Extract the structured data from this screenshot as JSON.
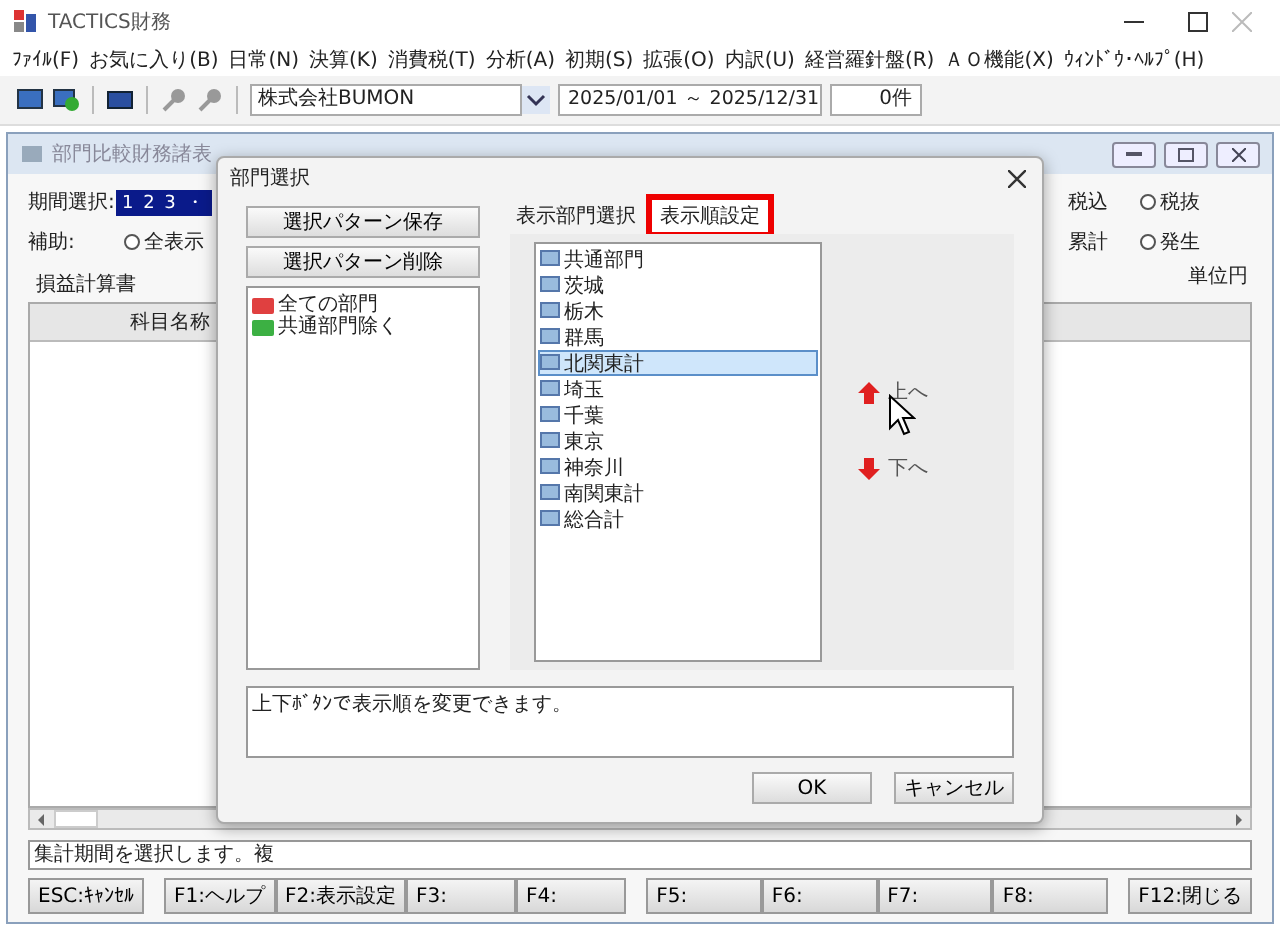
{
  "window": {
    "title": "TACTICS財務"
  },
  "menu": [
    "ﾌｧｲﾙ(F)",
    "お気に入り(B)",
    "日常(N)",
    "決算(K)",
    "消費税(T)",
    "分析(A)",
    "初期(S)",
    "拡張(O)",
    "内訳(U)",
    "経営羅針盤(R)",
    "ＡＯ機能(X)",
    "ｳｨﾝﾄﾞｳ･ﾍﾙﾌﾟ(H)"
  ],
  "toolbar": {
    "company": "株式会社BUMON",
    "period": "2025/01/01 ～ 2025/12/31",
    "count": "0件"
  },
  "report_window": {
    "title": "部門比較財務諸表",
    "period_label": "期間選択:",
    "period_value": "1 2 3 ・",
    "aux_label": "補助:",
    "aux_options": [
      {
        "label": "全表示",
        "selected": false
      }
    ],
    "tax_options": [
      {
        "kind": "text",
        "label": "税込"
      },
      {
        "kind": "radio",
        "label": "税抜",
        "selected": false
      }
    ],
    "sum_options": [
      {
        "kind": "text",
        "label": "累計"
      },
      {
        "kind": "radio",
        "label": "発生",
        "selected": false
      }
    ],
    "unit": "単位円",
    "tab": "損益計算書",
    "column": "科目名称",
    "status": "集計期間を選択します。複"
  },
  "function_keys": [
    "ESC:ｷｬﾝｾﾙ",
    "F1:ヘルプ",
    "F2:表示設定",
    "F3:",
    "F4:",
    "F5:",
    "F6:",
    "F7:",
    "F8:",
    "F12:閉じる"
  ],
  "dialog": {
    "title": "部門選択",
    "buttons": [
      "選択パターン保存",
      "選択パターン削除"
    ],
    "patterns": [
      {
        "label": "全ての部門",
        "color": "#e04040"
      },
      {
        "label": "共通部門除く",
        "color": "#3cb043"
      }
    ],
    "tabs": [
      {
        "label": "表示部門選択",
        "selected": false
      },
      {
        "label": "表示順設定",
        "selected": true
      }
    ],
    "departments": [
      {
        "label": "共通部門",
        "selected": false
      },
      {
        "label": "茨城",
        "selected": false
      },
      {
        "label": "栃木",
        "selected": false
      },
      {
        "label": "群馬",
        "selected": false
      },
      {
        "label": "北関東計",
        "selected": true
      },
      {
        "label": "埼玉",
        "selected": false
      },
      {
        "label": "千葉",
        "selected": false
      },
      {
        "label": "東京",
        "selected": false
      },
      {
        "label": "神奈川",
        "selected": false
      },
      {
        "label": "南関東計",
        "selected": false
      },
      {
        "label": "総合計",
        "selected": false
      }
    ],
    "move_up": "上へ",
    "move_down": "下へ",
    "message": "上下ﾎﾞﾀﾝで表示順を変更できます。",
    "ok": "OK",
    "cancel": "キャンセル"
  }
}
